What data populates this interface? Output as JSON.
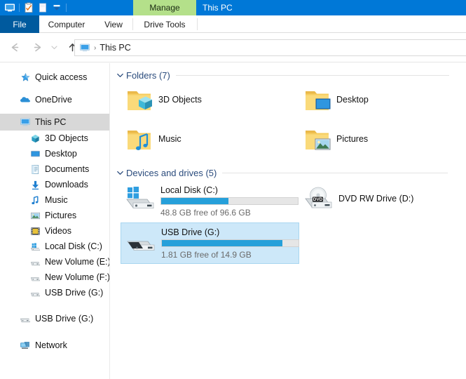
{
  "window": {
    "title": "This PC",
    "contextual_tab": "Manage",
    "quick_access_icons": [
      "this-pc-icon",
      "properties-icon",
      "new-folder-icon",
      "customize-dropdown-icon"
    ]
  },
  "ribbon": {
    "tabs": [
      {
        "label": "File",
        "name": "tab-file",
        "active": true
      },
      {
        "label": "Computer",
        "name": "tab-computer",
        "active": false
      },
      {
        "label": "View",
        "name": "tab-view",
        "active": false
      },
      {
        "label": "Drive Tools",
        "name": "tab-drive-tools",
        "active": false
      }
    ]
  },
  "navbar": {
    "back_icon": "back-arrow-icon",
    "forward_icon": "forward-arrow-icon",
    "recent_icon": "recent-locations-chevron-icon",
    "up_icon": "up-arrow-icon",
    "address": {
      "icon": "this-pc-icon",
      "crumb": "This PC",
      "separator": "›"
    }
  },
  "sidebar": {
    "items": [
      {
        "label": "Quick access",
        "icon": "star-pin-icon",
        "level": 0,
        "selected": false
      },
      {
        "label": "OneDrive",
        "icon": "cloud-icon",
        "level": 0,
        "selected": false
      },
      {
        "label": "This PC",
        "icon": "this-pc-icon",
        "level": 0,
        "selected": true
      },
      {
        "label": "3D Objects",
        "icon": "3d-objects-icon",
        "level": 1,
        "selected": false
      },
      {
        "label": "Desktop",
        "icon": "desktop-icon",
        "level": 1,
        "selected": false
      },
      {
        "label": "Documents",
        "icon": "documents-icon",
        "level": 1,
        "selected": false
      },
      {
        "label": "Downloads",
        "icon": "downloads-icon",
        "level": 1,
        "selected": false
      },
      {
        "label": "Music",
        "icon": "music-icon",
        "level": 1,
        "selected": false
      },
      {
        "label": "Pictures",
        "icon": "pictures-icon",
        "level": 1,
        "selected": false
      },
      {
        "label": "Videos",
        "icon": "videos-icon",
        "level": 1,
        "selected": false
      },
      {
        "label": "Local Disk (C:)",
        "icon": "windows-drive-icon",
        "level": 1,
        "selected": false
      },
      {
        "label": "New Volume (E:)",
        "icon": "drive-icon",
        "level": 1,
        "selected": false
      },
      {
        "label": "New Volume (F:)",
        "icon": "drive-icon",
        "level": 1,
        "selected": false
      },
      {
        "label": "USB Drive (G:)",
        "icon": "drive-icon",
        "level": 1,
        "selected": false
      },
      {
        "label": "USB Drive (G:)",
        "icon": "drive-icon",
        "level": 0,
        "selected": false
      },
      {
        "label": "Network",
        "icon": "network-icon",
        "level": 0,
        "selected": false
      }
    ]
  },
  "content": {
    "groups": [
      {
        "title": "Folders (7)",
        "name": "group-folders",
        "chevron": "chevron-down-icon"
      },
      {
        "title": "Devices and drives (5)",
        "name": "group-devices-and-drives",
        "chevron": "chevron-down-icon"
      }
    ],
    "folders": [
      {
        "label": "3D Objects",
        "icon": "folder-3d-objects-icon"
      },
      {
        "label": "Desktop",
        "icon": "folder-desktop-icon"
      },
      {
        "label": "Music",
        "icon": "folder-music-icon"
      },
      {
        "label": "Pictures",
        "icon": "folder-pictures-icon"
      }
    ],
    "drives": [
      {
        "label": "Local Disk (C:)",
        "icon": "windows-drive-icon",
        "has_bar": true,
        "used_percent": 49,
        "capacity_text": "48.8 GB free of 96.6 GB",
        "free": "48.8 GB",
        "total": "96.6 GB",
        "selected": false
      },
      {
        "label": "DVD RW Drive (D:)",
        "icon": "dvd-drive-icon",
        "has_bar": false,
        "used_percent": 0,
        "capacity_text": "",
        "selected": false
      },
      {
        "label": "USB Drive (G:)",
        "icon": "usb-drive-icon",
        "has_bar": true,
        "used_percent": 88,
        "capacity_text": "1.81 GB free of 14.9 GB",
        "free": "1.81 GB",
        "total": "14.9 GB",
        "selected": true
      }
    ]
  },
  "colors": {
    "titlebar": "#0078d7",
    "file_tab": "#005a9e",
    "manage_tab": "#b4e08a",
    "group_header_text": "#2a4b7c",
    "progress_fill": "#26a0da",
    "selection_bg": "#cde8f9",
    "selection_border": "#a8d6f0",
    "sidebar_selected_bg": "#d8d8d8"
  }
}
